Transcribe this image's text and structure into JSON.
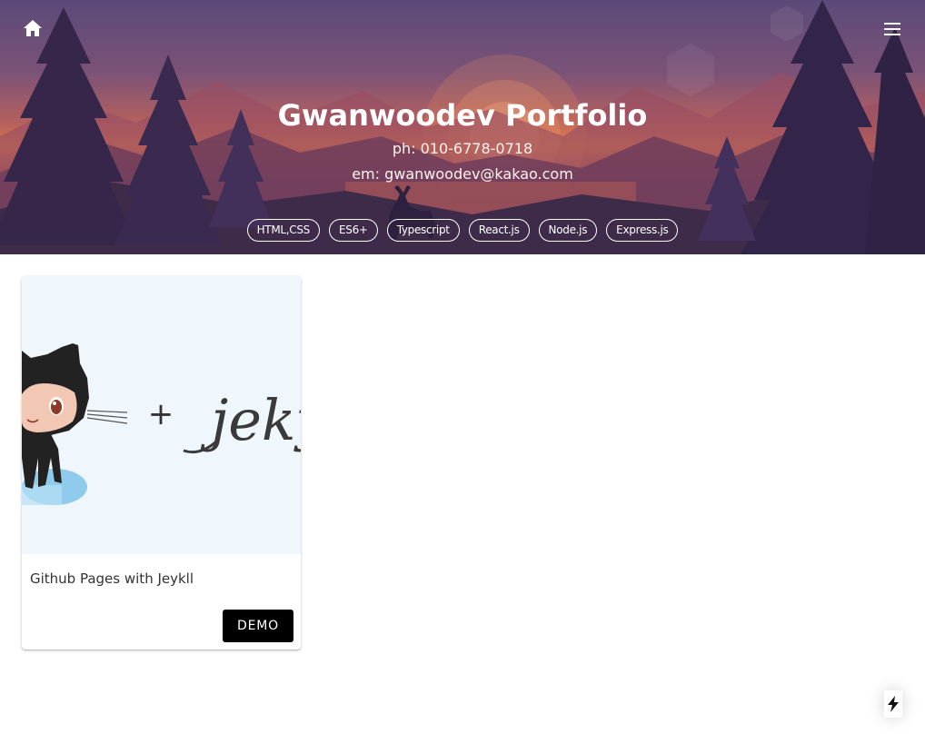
{
  "header": {
    "title_light": "Gwanwoodev",
    "title_bold": "Portfolio",
    "phone": "ph: 010-6778-0718",
    "email": "em: gwanwoodev@kakao.com",
    "home_icon": "home-icon",
    "menu_icon": "hamburger-menu-icon"
  },
  "skills": [
    {
      "label": "HTML,CSS"
    },
    {
      "label": "ES6+"
    },
    {
      "label": "Typescript"
    },
    {
      "label": "React.js"
    },
    {
      "label": "Node.js"
    },
    {
      "label": "Express.js"
    }
  ],
  "projects": [
    {
      "title": "Github Pages with Jeykll",
      "image_text": "jekyll",
      "action_label": "DEMO"
    }
  ],
  "floating_action": {
    "icon": "lightning-bolt-icon"
  }
}
